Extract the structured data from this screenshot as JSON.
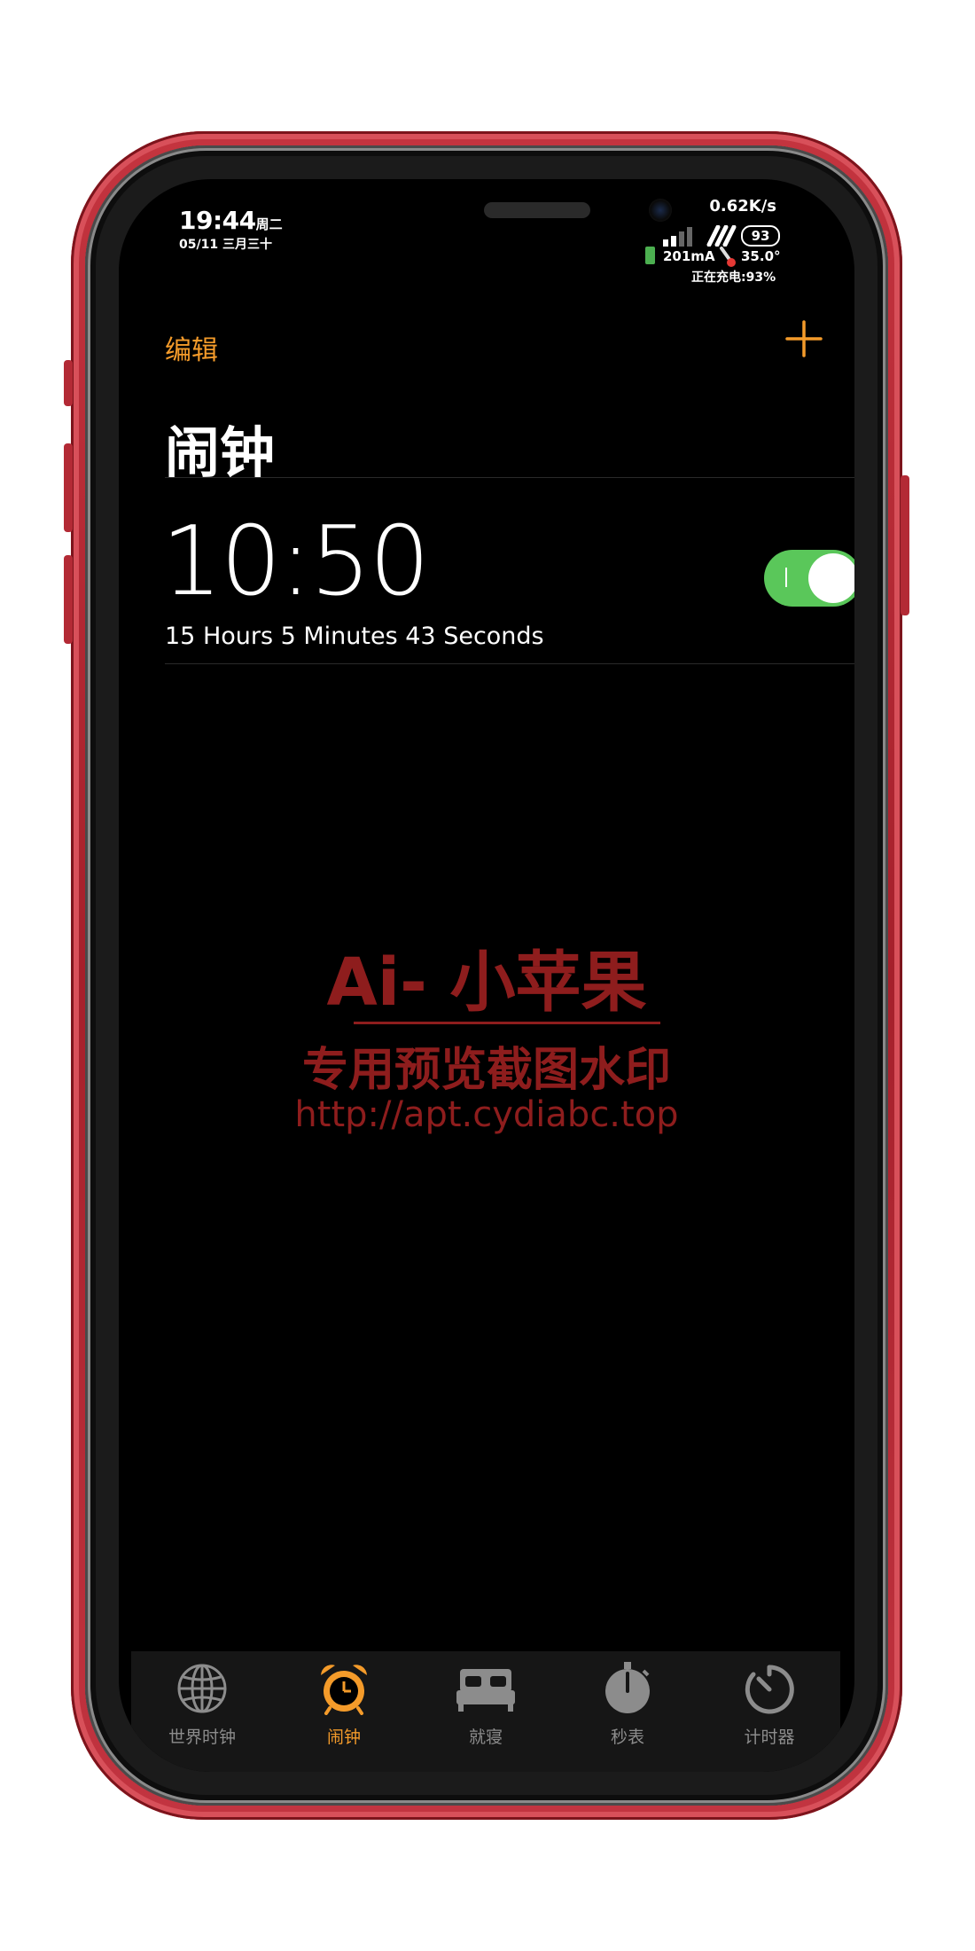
{
  "status": {
    "time": "19:44",
    "weekday": "周二",
    "date": "05/11 三月三十",
    "speed": "0.62K/s",
    "battery": "93",
    "current": "201mA",
    "temperature": "35.0°",
    "charging": "正在充电:93%"
  },
  "nav": {
    "edit_label": "编辑",
    "add_icon": "plus-icon"
  },
  "page": {
    "title": "闹钟"
  },
  "alarms": [
    {
      "time": "10:50",
      "countdown": "15 Hours 5 Minutes 43 Seconds",
      "enabled": true
    }
  ],
  "watermark": {
    "line1": "Ai- 小苹果",
    "line2": "专用预览截图水印",
    "line3": "http://apt.cydiabc.top"
  },
  "tabs": [
    {
      "label": "世界时钟",
      "icon": "globe-icon",
      "active": false
    },
    {
      "label": "闹钟",
      "icon": "alarm-clock-icon",
      "active": true
    },
    {
      "label": "就寝",
      "icon": "bed-icon",
      "active": false
    },
    {
      "label": "秒表",
      "icon": "stopwatch-icon",
      "active": false
    },
    {
      "label": "计时器",
      "icon": "timer-icon",
      "active": false
    }
  ],
  "colors": {
    "accent": "#f49b2a",
    "toggle_on": "#5ac75a",
    "frame": "#b32a35",
    "watermark": "#8e1d1d"
  }
}
